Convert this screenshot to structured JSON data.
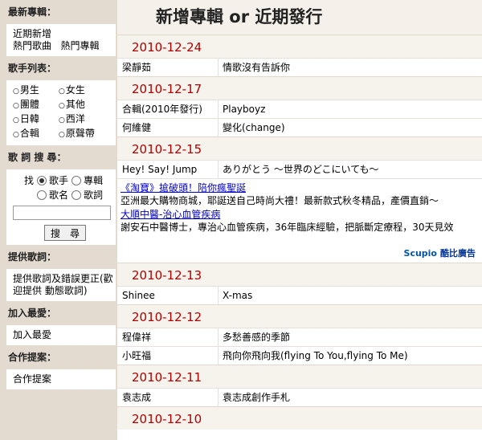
{
  "sidebar": {
    "latest_head": "最新專輯：",
    "latest_links": [
      "近期新增",
      "熱門歌曲",
      "熱門專輯"
    ],
    "singers_head": "歌手列表：",
    "singers": [
      "男生",
      "女生",
      "團體",
      "其他",
      "日韓",
      "西洋",
      "合輯",
      "原聲帶"
    ],
    "search_head": "歌 詞 搜 尋：",
    "search_label": "找",
    "search_options": [
      "歌手",
      "專輯",
      "歌名",
      "歌詞"
    ],
    "search_value": "",
    "search_button": "搜　尋",
    "provide_head": "提供歌詞：",
    "provide_text": "提供歌詞及錯誤更正(歡迎提供 動態歌詞)",
    "fav_head": "加入最愛：",
    "fav_text": "加入最愛",
    "coop_head": "合作提案：",
    "coop_text": "合作提案"
  },
  "main": {
    "title": "新增專輯 or 近期發行",
    "groups": [
      {
        "date": "2010-12-24",
        "rows": [
          {
            "artist": "梁靜茹",
            "title": "情歌沒有告訴你"
          }
        ]
      },
      {
        "date": "2010-12-17",
        "rows": [
          {
            "artist": "合輯(2010年發行)",
            "title": "Playboyz"
          },
          {
            "artist": "何維健",
            "title": "變化(change)"
          }
        ]
      },
      {
        "date": "2010-12-15",
        "rows": [
          {
            "artist": "Hey! Say! Jump",
            "title": "ありがとう ～世界のどこにいても～"
          }
        ]
      },
      {
        "date": "2010-12-13",
        "rows": [
          {
            "artist": "Shinee",
            "title": "X-mas"
          }
        ]
      },
      {
        "date": "2010-12-12",
        "rows": [
          {
            "artist": "程偉祥",
            "title": "多愁善感的季節"
          },
          {
            "artist": "小旺福",
            "title": "飛向你飛向我(flying To You,flying To Me)"
          }
        ]
      },
      {
        "date": "2010-12-11",
        "rows": [
          {
            "artist": "袁志成",
            "title": "袁志成創作手札"
          }
        ]
      },
      {
        "date": "2010-12-10",
        "rows": []
      }
    ],
    "ads": [
      {
        "link": "《淘寶》搶破頭！陪你瘋聖誕",
        "desc": "亞洲最大購物商城，耶誕送自己時尚大禮！最新款式秋冬精品，產價直銷～"
      },
      {
        "link": "大順中醫-治心血管疾病",
        "desc": "謝安石中醫博士，專治心血管疾病，36年臨床經驗，把脈斷定療程，30天見效"
      }
    ],
    "ad_brand": "Scupio",
    "ad_brand_text": "酷比廣告"
  }
}
